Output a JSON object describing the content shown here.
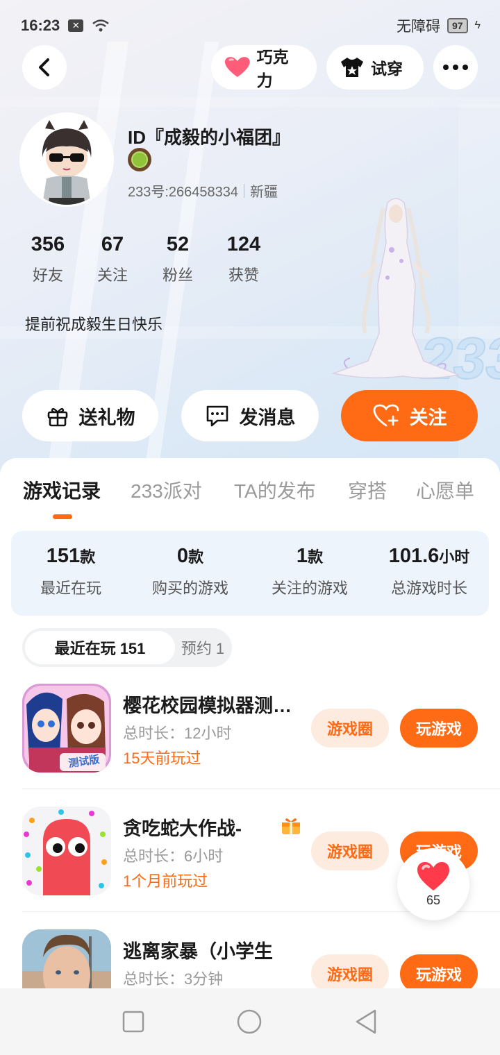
{
  "status_bar": {
    "time": "16:23",
    "accessibility": "无障碍",
    "battery": "97"
  },
  "header": {
    "chocolate_label": "巧克力",
    "tryon_label": "试穿"
  },
  "profile": {
    "name": "ID『成毅的小福团』",
    "id_text": "233号:266458334",
    "region": "新疆",
    "bio": "提前祝成毅生日快乐",
    "stats": [
      {
        "value": "356",
        "label": "好友"
      },
      {
        "value": "67",
        "label": "关注"
      },
      {
        "value": "52",
        "label": "粉丝"
      },
      {
        "value": "124",
        "label": "获赞"
      }
    ]
  },
  "actions": {
    "gift": "送礼物",
    "message": "发消息",
    "follow": "关注"
  },
  "tabs": [
    "游戏记录",
    "233派对",
    "TA的发布",
    "穿搭",
    "心愿单"
  ],
  "summary": [
    {
      "num": "151",
      "unit": "款",
      "label": "最近在玩"
    },
    {
      "num": "0",
      "unit": "款",
      "label": "购买的游戏"
    },
    {
      "num": "1",
      "unit": "款",
      "label": "关注的游戏"
    },
    {
      "num": "101.6",
      "unit": "小时",
      "label": "总游戏时长"
    }
  ],
  "segment": {
    "active": "最近在玩 151",
    "inactive": "预约 1"
  },
  "games": [
    {
      "title": "樱花校园模拟器测试版",
      "duration": "总时长：12小时",
      "last_played": "15天前玩过",
      "circle": "游戏圈",
      "play": "玩游戏",
      "icon_tag": "测试版"
    },
    {
      "title": "贪吃蛇大作战-",
      "duration": "总时长：6小时",
      "last_played": "1个月前玩过",
      "circle": "游戏圈",
      "play": "玩游戏"
    },
    {
      "title": "逃离家暴（小学生",
      "duration": "总时长：3分钟",
      "last_played": "",
      "circle": "游戏圈",
      "play": "玩游戏"
    }
  ],
  "like_fab": {
    "count": "65"
  },
  "colors": {
    "accent": "#ff6a14",
    "accent_light": "#fdebe0",
    "summary_bg": "#eef4fc"
  },
  "icons": [
    "back-icon",
    "heart-icon",
    "tshirt-icon",
    "more-icon",
    "gift-icon",
    "chat-icon",
    "heart-plus-icon",
    "square-nav-icon",
    "circle-nav-icon",
    "triangle-nav-icon"
  ]
}
